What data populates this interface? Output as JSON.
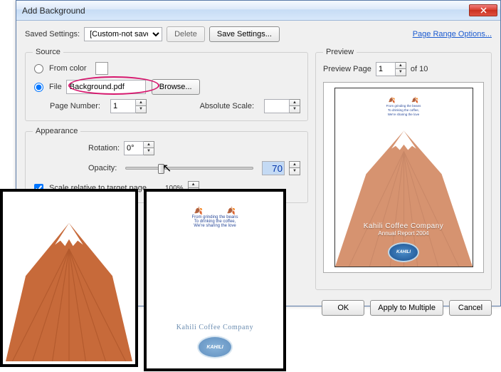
{
  "window": {
    "title": "Add Background"
  },
  "topbar": {
    "saved_label": "Saved Settings:",
    "saved_value": "[Custom-not saved]",
    "delete": "Delete",
    "save": "Save Settings...",
    "page_range": "Page Range Options..."
  },
  "source": {
    "legend": "Source",
    "from_color": "From color",
    "file": "File",
    "file_value": "Background.pdf",
    "browse": "Browse...",
    "page_number_label": "Page Number:",
    "page_number_value": "1",
    "absolute_scale_label": "Absolute Scale:",
    "absolute_scale_value": ""
  },
  "appearance": {
    "legend": "Appearance",
    "rotation_label": "Rotation:",
    "rotation_value": "0°",
    "opacity_label": "Opacity:",
    "opacity_value": "70",
    "slider_label": "100%",
    "scale_relative": "Scale relative to target page",
    "scale_value": ""
  },
  "preview": {
    "legend": "Preview",
    "page_label": "Preview Page",
    "page_value": "1",
    "of_label": "of 10",
    "tagline1": "From grinding the beans",
    "tagline2": "To drinking the coffee,",
    "tagline3": "We're sharing the love",
    "company": "Kahili Coffee Company",
    "subtitle": "Annual Report 2004",
    "logo": "KAHILI"
  },
  "buttons": {
    "ok": "OK",
    "apply": "Apply to Multiple",
    "cancel": "Cancel"
  }
}
